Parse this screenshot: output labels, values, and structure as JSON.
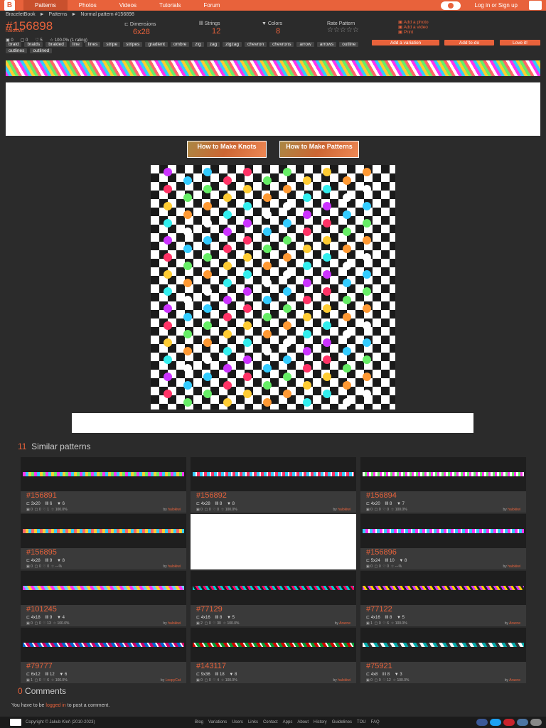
{
  "nav": {
    "logo": "B",
    "items": [
      {
        "label": "Patterns",
        "active": true
      },
      {
        "label": "Photos"
      },
      {
        "label": "Videos"
      },
      {
        "label": "Tutorials"
      },
      {
        "label": "Forum"
      }
    ],
    "login": "Log in or Sign up"
  },
  "breadcrumb": [
    "BraceletBook",
    "►",
    "Patterns",
    "►",
    "Normal pattern #156898"
  ],
  "pattern": {
    "id": "#156898",
    "author": "halokiwi",
    "dimensions_label": "Dimensions",
    "dimensions": "6x28",
    "strings_label": "Strings",
    "strings": "12",
    "colors_label": "Colors",
    "colors": "8",
    "rate_label": "Rate Pattern",
    "rating_stars": "☆☆☆☆☆",
    "stats": [
      "0",
      "0",
      "5",
      "100.0% (1 rating)"
    ]
  },
  "actions": {
    "add_photo": "Add a photo",
    "add_video": "Add a video",
    "print": "Print",
    "add_variation": "Add a variation",
    "add_todo": "Add to-do",
    "love": "Love it!"
  },
  "tags": [
    "braid",
    "braids",
    "braided",
    "line",
    "lines",
    "stripe",
    "stripes",
    "gradient",
    "ombre",
    "zig",
    "zag",
    "zigzag",
    "chevron",
    "chevrons",
    "arrow",
    "arrows",
    "outline",
    "outlines",
    "outlined"
  ],
  "howto": {
    "knots": "How to Make Knots",
    "patterns": "How to Make Patterns"
  },
  "similar": {
    "count": "11",
    "title": "Similar patterns",
    "cards": [
      {
        "id": "#156891",
        "dim": "3x20",
        "strings": "6",
        "colors": "6",
        "s1": "0",
        "s2": "0",
        "love": "1",
        "rate": "100.0%",
        "by": "halokiwi"
      },
      {
        "id": "#156892",
        "dim": "4x28",
        "strings": "8",
        "colors": "8",
        "s1": "0",
        "s2": "0",
        "love": "0",
        "rate": "100.0%",
        "by": "halokiwi"
      },
      {
        "id": "#156894",
        "dim": "4x20",
        "strings": "8",
        "colors": "7",
        "s1": "0",
        "s2": "0",
        "love": "0",
        "rate": "100.0%",
        "by": "halokiwi"
      },
      {
        "id": "#156895",
        "dim": "4x28",
        "strings": "9",
        "colors": "8",
        "s1": "0",
        "s2": "0",
        "love": "0",
        "rate": "---%",
        "by": "halokiwi"
      },
      {
        "id": "",
        "dim": "",
        "strings": "",
        "colors": "",
        "s1": "",
        "s2": "",
        "love": "",
        "rate": "",
        "by": ""
      },
      {
        "id": "#156896",
        "dim": "5x24",
        "strings": "10",
        "colors": "8",
        "s1": "0",
        "s2": "0",
        "love": "0",
        "rate": "---%",
        "by": "halokiwi"
      },
      {
        "id": "#101245",
        "dim": "4x18",
        "strings": "9",
        "colors": "4",
        "s1": "0",
        "s2": "0",
        "love": "13",
        "rate": "100.0%",
        "by": "halokiwi"
      },
      {
        "id": "#77129",
        "dim": "4x16",
        "strings": "8",
        "colors": "5",
        "s1": "2",
        "s2": "0",
        "love": "30",
        "rate": "100.0%",
        "by": "Aracne"
      },
      {
        "id": "#77122",
        "dim": "4x16",
        "strings": "8",
        "colors": "5",
        "s1": "1",
        "s2": "0",
        "love": "6",
        "rate": "100.0%",
        "by": "Aracne"
      },
      {
        "id": "#79777",
        "dim": "6x12",
        "strings": "12",
        "colors": "6",
        "s1": "1",
        "s2": "0",
        "love": "6",
        "rate": "100.0%",
        "by": "LoopyCat"
      },
      {
        "id": "#143117",
        "dim": "9x36",
        "strings": "18",
        "colors": "8",
        "s1": "0",
        "s2": "0",
        "love": "4",
        "rate": "100.0%",
        "by": "halokiwi"
      },
      {
        "id": "#75921",
        "dim": "4x8",
        "strings": "8",
        "colors": "3",
        "s1": "0",
        "s2": "0",
        "love": "12",
        "rate": "100.0%",
        "by": "Aracne"
      }
    ]
  },
  "comments": {
    "count": "0",
    "title": "Comments",
    "note_pre": "You have to be",
    "note_link": "logged in",
    "note_post": "to post a comment."
  },
  "footer": {
    "copyright": "Copyright © Jakub Kleň (2010-2023)",
    "links": [
      "Blog",
      "Variations",
      "Users",
      "Links",
      "Contact",
      "Apps",
      "About",
      "History",
      "Guidelines",
      "TOU",
      "FAQ"
    ]
  },
  "colors": {
    "accent": "#e8623b",
    "bg": "#2b2b2b"
  }
}
